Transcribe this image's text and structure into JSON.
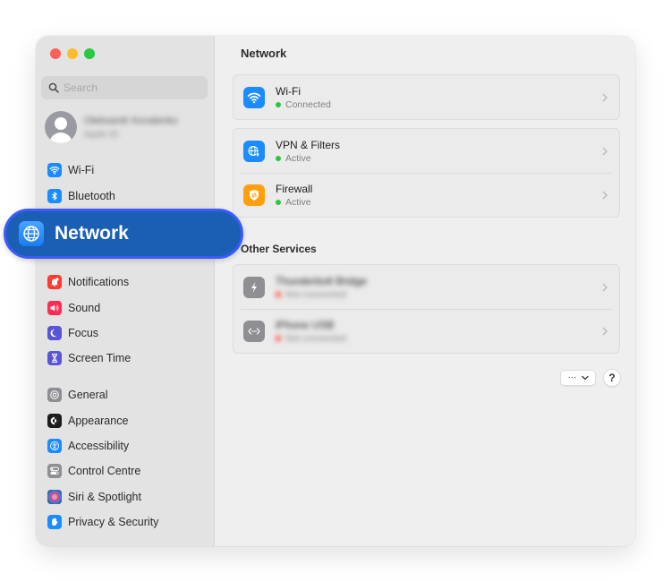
{
  "window": {
    "traffic_lights": [
      "close",
      "minimize",
      "zoom"
    ]
  },
  "sidebar": {
    "search": {
      "placeholder": "Search",
      "value": ""
    },
    "profile": {
      "name": "Oleksandr Kovalenko",
      "subtitle": "Apple ID",
      "blurred": true
    },
    "groups": [
      [
        {
          "label": "Wi-Fi",
          "icon": "wifi-icon",
          "color": "#1a8cff"
        },
        {
          "label": "Bluetooth",
          "icon": "bluetooth-icon",
          "color": "#1a8cff"
        },
        {
          "label": "Network",
          "icon": "globe-icon",
          "color": "#1a8cff",
          "selected": true
        }
      ],
      [
        {
          "label": "Notifications",
          "icon": "bell-icon",
          "color": "#ff3b30"
        },
        {
          "label": "Sound",
          "icon": "speaker-icon",
          "color": "#ff2d55"
        },
        {
          "label": "Focus",
          "icon": "moon-icon",
          "color": "#5856d6"
        },
        {
          "label": "Screen Time",
          "icon": "hourglass-icon",
          "color": "#5856d6"
        }
      ],
      [
        {
          "label": "General",
          "icon": "gear-icon",
          "color": "#8e8e93"
        },
        {
          "label": "Appearance",
          "icon": "appearance-icon",
          "color": "#1c1c1e"
        },
        {
          "label": "Accessibility",
          "icon": "accessibility-icon",
          "color": "#1a8cff"
        },
        {
          "label": "Control Centre",
          "icon": "toggles-icon",
          "color": "#8e8e93"
        },
        {
          "label": "Siri & Spotlight",
          "icon": "siri-icon",
          "color": "#3a2a4a"
        },
        {
          "label": "Privacy & Security",
          "icon": "hand-icon",
          "color": "#1a8cff"
        }
      ]
    ]
  },
  "highlight": {
    "label": "Network"
  },
  "main": {
    "title": "Network",
    "wifi": {
      "title": "Wi-Fi",
      "status": "Connected",
      "status_color": "#28c840"
    },
    "security": [
      {
        "title": "VPN & Filters",
        "status": "Active",
        "status_color": "#28c840"
      },
      {
        "title": "Firewall",
        "status": "Active",
        "status_color": "#28c840"
      }
    ],
    "other_services_title": "Other Services",
    "other_services": [
      {
        "title": "Thunderbolt Bridge",
        "status": "Not connected",
        "status_color": "#ff3b30",
        "blurred": true
      },
      {
        "title": "iPhone USB",
        "status": "Not connected",
        "status_color": "#ff3b30",
        "blurred": true
      }
    ],
    "more_button_label": "···",
    "help_button_label": "?"
  }
}
